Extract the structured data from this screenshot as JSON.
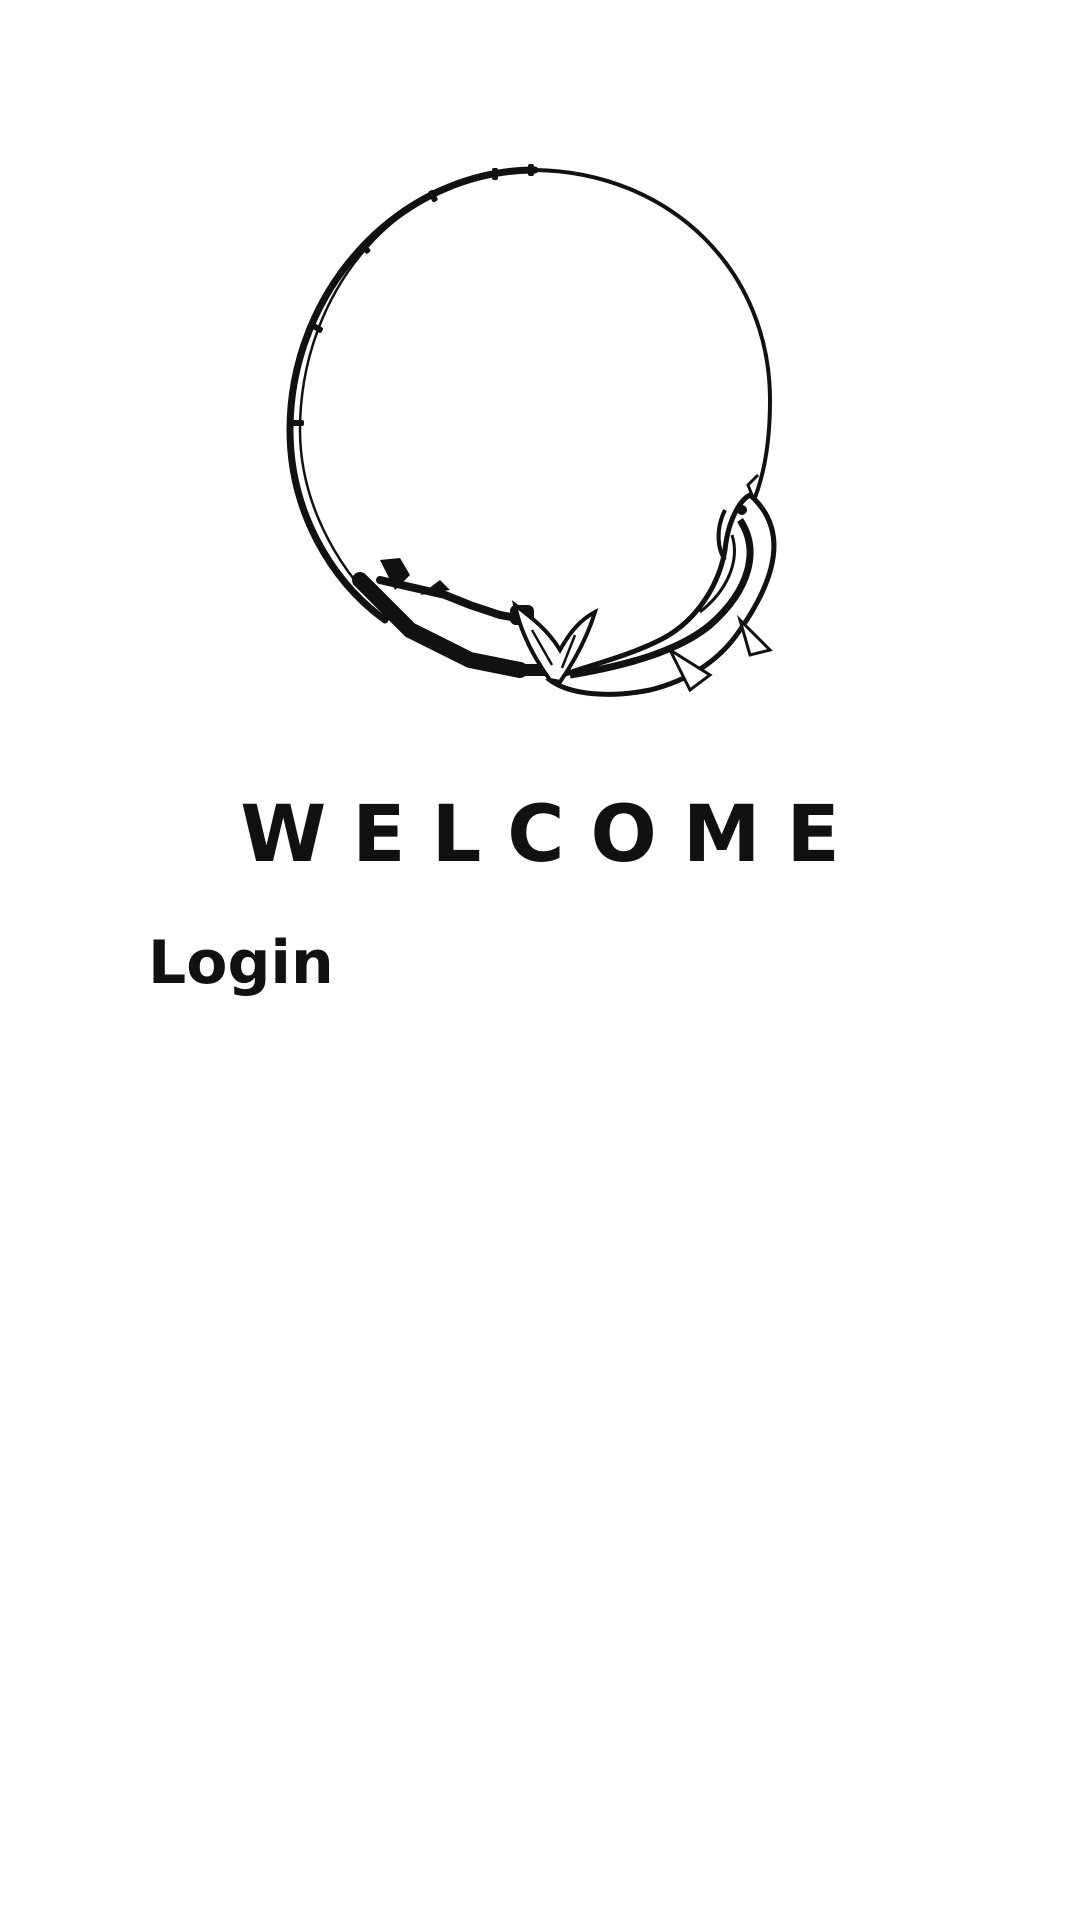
{
  "screen": {
    "logo": {
      "icon": "fishing-rod-fish-icon"
    },
    "welcome_title": "WELCOME",
    "login_label": "Login"
  },
  "colors": {
    "background": "#ffffff",
    "text": "#111111"
  }
}
